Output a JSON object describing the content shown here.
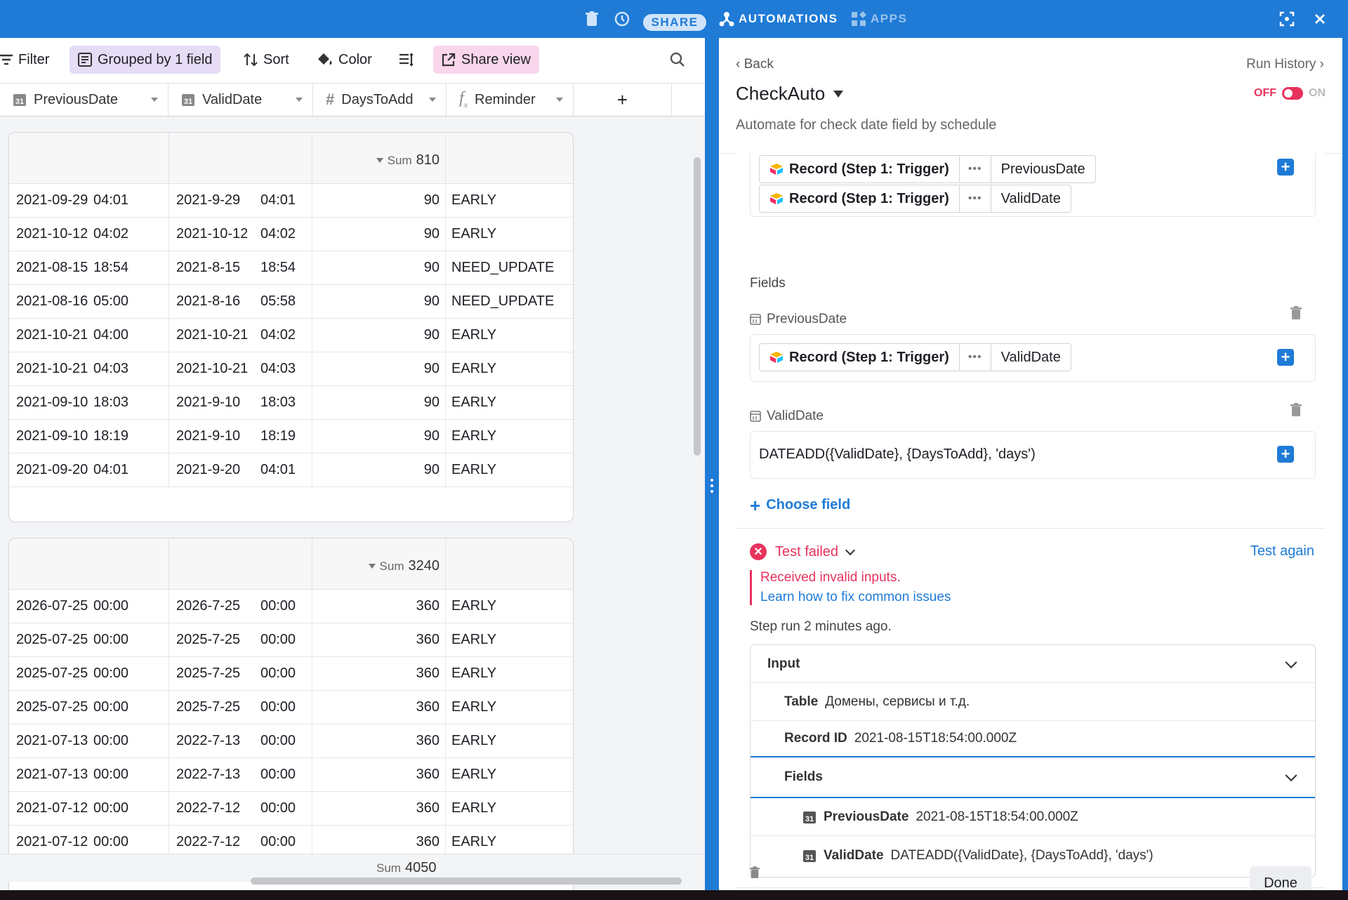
{
  "topbar": {
    "share_label": "SHARE",
    "automations_label": "AUTOMATIONS",
    "apps_label": "APPS"
  },
  "toolbar": {
    "filter_label": "Filter",
    "grouped_label": "Grouped by 1 field",
    "sort_label": "Sort",
    "color_label": "Color",
    "shareview_label": "Share view"
  },
  "columns": [
    {
      "name": "PreviousDate",
      "icon": "calendar-icon"
    },
    {
      "name": "ValidDate",
      "icon": "calendar-icon"
    },
    {
      "name": "DaysToAdd",
      "icon": "number-icon"
    },
    {
      "name": "Reminder",
      "icon": "formula-icon"
    }
  ],
  "add_column": "+",
  "groups": [
    {
      "sum_label": "Sum",
      "sum_value": "810",
      "rows": [
        [
          "2021-09-29",
          "04:01",
          "2021-9-29",
          "04:01",
          "90",
          "EARLY"
        ],
        [
          "2021-10-12",
          "04:02",
          "2021-10-12",
          "04:02",
          "90",
          "EARLY"
        ],
        [
          "2021-08-15",
          "18:54",
          "2021-8-15",
          "18:54",
          "90",
          "NEED_UPDATE"
        ],
        [
          "2021-08-16",
          "05:00",
          "2021-8-16",
          "05:58",
          "90",
          "NEED_UPDATE"
        ],
        [
          "2021-10-21",
          "04:00",
          "2021-10-21",
          "04:02",
          "90",
          "EARLY"
        ],
        [
          "2021-10-21",
          "04:03",
          "2021-10-21",
          "04:03",
          "90",
          "EARLY"
        ],
        [
          "2021-09-10",
          "18:03",
          "2021-9-10",
          "18:03",
          "90",
          "EARLY"
        ],
        [
          "2021-09-10",
          "18:19",
          "2021-9-10",
          "18:19",
          "90",
          "EARLY"
        ],
        [
          "2021-09-20",
          "04:01",
          "2021-9-20",
          "04:01",
          "90",
          "EARLY"
        ]
      ]
    },
    {
      "sum_label": "Sum",
      "sum_value": "3240",
      "rows": [
        [
          "2026-07-25",
          "00:00",
          "2026-7-25",
          "00:00",
          "360",
          "EARLY"
        ],
        [
          "2025-07-25",
          "00:00",
          "2025-7-25",
          "00:00",
          "360",
          "EARLY"
        ],
        [
          "2025-07-25",
          "00:00",
          "2025-7-25",
          "00:00",
          "360",
          "EARLY"
        ],
        [
          "2025-07-25",
          "00:00",
          "2025-7-25",
          "00:00",
          "360",
          "EARLY"
        ],
        [
          "2021-07-13",
          "00:00",
          "2022-7-13",
          "00:00",
          "360",
          "EARLY"
        ],
        [
          "2021-07-13",
          "00:00",
          "2022-7-13",
          "00:00",
          "360",
          "EARLY"
        ],
        [
          "2021-07-12",
          "00:00",
          "2022-7-12",
          "00:00",
          "360",
          "EARLY"
        ],
        [
          "2021-07-12",
          "00:00",
          "2022-7-12",
          "00:00",
          "360",
          "EARLY"
        ]
      ]
    }
  ],
  "total_sum": {
    "label": "Sum",
    "value": "4050"
  },
  "panel": {
    "back": "Back",
    "run_history": "Run History",
    "title": "CheckAuto",
    "off": "OFF",
    "on": "ON",
    "description": "Automate for check date field by schedule",
    "tokens_top": [
      {
        "record": "Record (Step 1: Trigger)",
        "dots": "•••",
        "field": "PreviousDate"
      },
      {
        "record": "Record (Step 1: Trigger)",
        "dots": "•••",
        "field": "ValidDate"
      }
    ],
    "fields_heading": "Fields",
    "field1_name": "PreviousDate",
    "field1_token": {
      "record": "Record (Step 1: Trigger)",
      "dots": "•••",
      "field": "ValidDate"
    },
    "field2_name": "ValidDate",
    "field2_formula": "DATEADD({ValidDate}, {DaysToAdd}, 'days')",
    "choose_field": "Choose field",
    "test_status": "Test failed",
    "test_again": "Test again",
    "error_msg": "Received invalid inputs.",
    "error_link": "Learn how to fix common issues",
    "step_run": "Step run 2 minutes ago.",
    "input": {
      "heading": "Input",
      "table_label": "Table",
      "table_value": "Домены, сервисы и т.д.",
      "record_id_label": "Record ID",
      "record_id_value": "2021-08-15T18:54:00.000Z",
      "fields_heading": "Fields",
      "f1_label": "PreviousDate",
      "f1_value": "2021-08-15T18:54:00.000Z",
      "f2_label": "ValidDate",
      "f2_value": "DATEADD({ValidDate}, {DaysToAdd}, 'days')"
    },
    "done": "Done"
  },
  "colors": {
    "accent": "#1f7bd6",
    "error": "#e8325e",
    "grouped_bg": "#e6dcf6",
    "shareview_bg": "#f9d6ec"
  }
}
